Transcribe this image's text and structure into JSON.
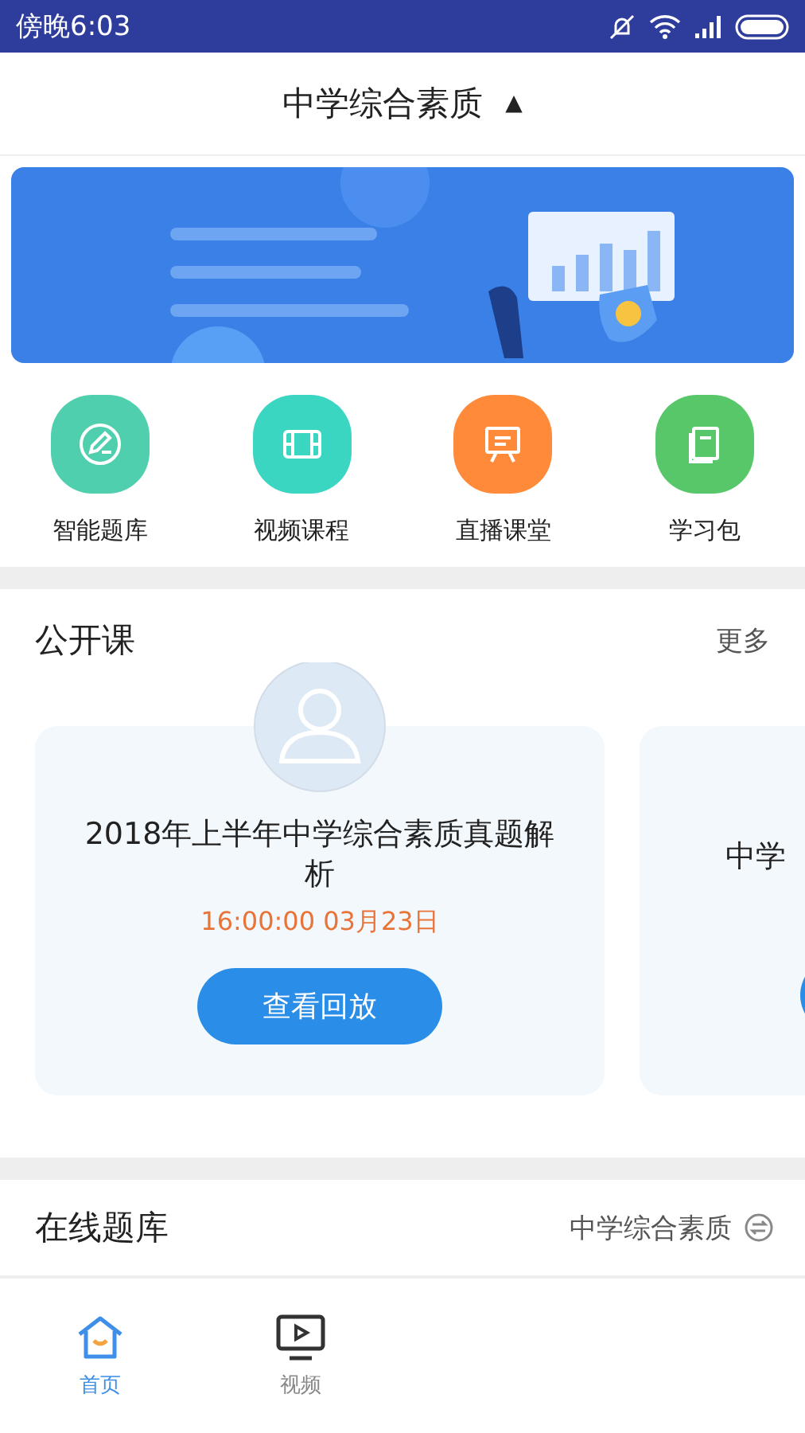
{
  "status_bar": {
    "time": "傍晚6:03"
  },
  "header": {
    "title": "中学综合素质",
    "arrow": "▲"
  },
  "shortcuts": [
    {
      "label": "智能题库",
      "kind": "pencil",
      "color": "#4fcfae"
    },
    {
      "label": "视频课程",
      "kind": "film",
      "color": "#3ad6c2"
    },
    {
      "label": "直播课堂",
      "kind": "board",
      "color": "#ff8a3a"
    },
    {
      "label": "学习包",
      "kind": "book",
      "color": "#58c76a"
    }
  ],
  "open_courses": {
    "title": "公开课",
    "more": "更多",
    "cards": [
      {
        "title": "2018年上半年中学综合素质真题解析",
        "time": "16:00:00  03月23日",
        "button": "查看回放"
      },
      {
        "title": "中学"
      }
    ]
  },
  "question_bank": {
    "title": "在线题库",
    "subject": "中学综合素质"
  },
  "tabs": [
    {
      "label": "首页",
      "kind": "home",
      "selected": true
    },
    {
      "label": "视频",
      "kind": "video",
      "selected": false
    }
  ]
}
